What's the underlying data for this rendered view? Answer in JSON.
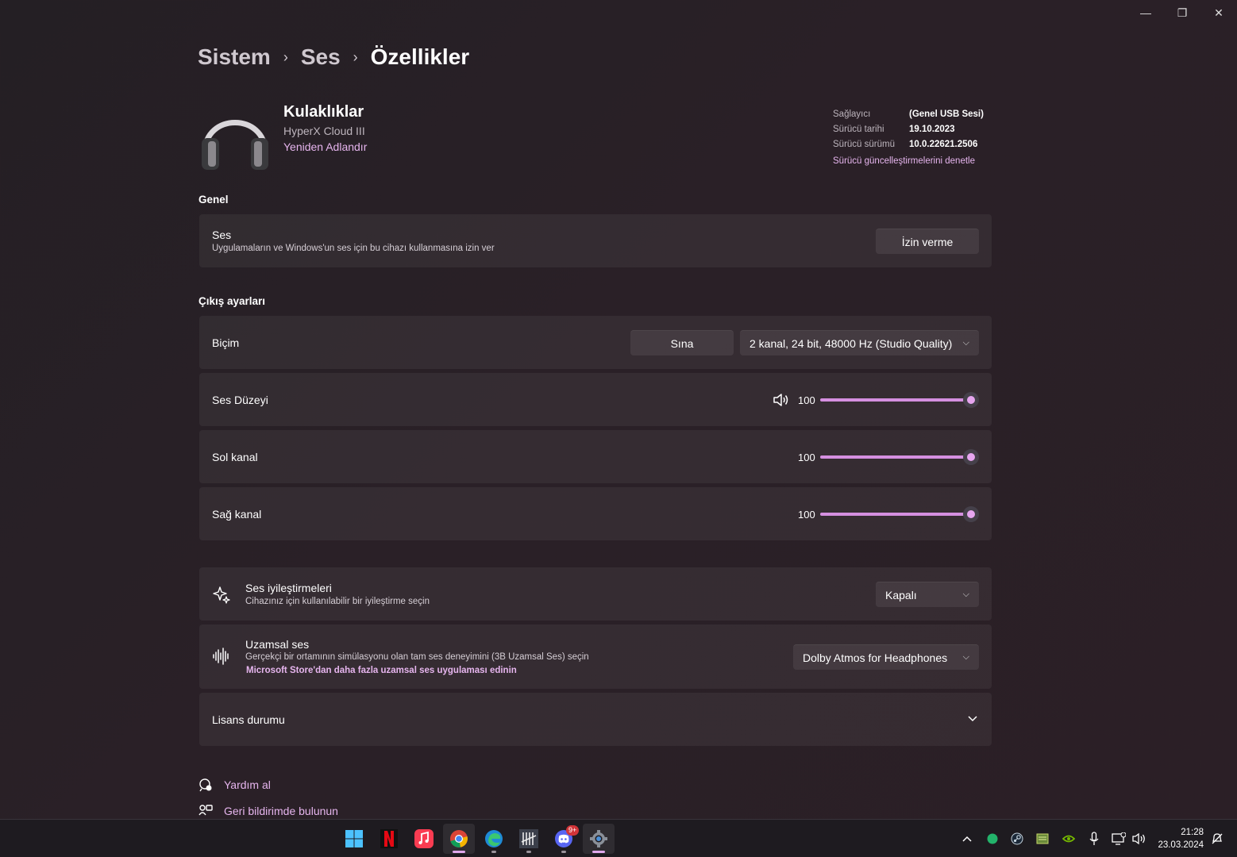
{
  "window_controls": {
    "minimize": "—",
    "restore": "❐",
    "close": "✕"
  },
  "breadcrumb": {
    "items": [
      "Sistem",
      "Ses"
    ],
    "current": "Özellikler",
    "separator": "›"
  },
  "device": {
    "name": "Kulaklıklar",
    "model": "HyperX Cloud III",
    "rename": "Yeniden Adlandır",
    "icon": "headphones-icon"
  },
  "driver": {
    "provider_label": "Sağlayıcı",
    "provider_value": "(Genel USB Sesi)",
    "date_label": "Sürücü tarihi",
    "date_value": "19.10.2023",
    "version_label": "Sürücü sürümü",
    "version_value": "10.0.22621.2506",
    "update_link": "Sürücü güncelleştirmelerini denetle"
  },
  "general": {
    "section_title": "Genel",
    "audio_title": "Ses",
    "audio_sub": "Uygulamaların ve Windows'un ses için bu cihazı kullanmasına izin ver",
    "deny_button": "İzin verme"
  },
  "output": {
    "section_title": "Çıkış ayarları",
    "format_label": "Biçim",
    "test_button": "Sına",
    "format_value": "2 kanal, 24 bit, 48000 Hz (Studio Quality)",
    "volume_label": "Ses Düzeyi",
    "volume_value": "100",
    "left_label": "Sol kanal",
    "left_value": "100",
    "right_label": "Sağ kanal",
    "right_value": "100"
  },
  "enhancements": {
    "title": "Ses iyileştirmeleri",
    "sub": "Cihazınız için kullanılabilir bir iyileştirme seçin",
    "value": "Kapalı"
  },
  "spatial": {
    "title": "Uzamsal ses",
    "sub": "Gerçekçi bir ortamının simülasyonu olan tam ses deneyimini (3B Uzamsal Ses) seçin",
    "link": "Microsoft Store'dan daha fazla uzamsal ses uygulaması edinin",
    "value": "Dolby Atmos for Headphones"
  },
  "license": {
    "title": "Lisans durumu"
  },
  "help": {
    "get_help": "Yardım al",
    "feedback": "Geri bildirimde bulunun"
  },
  "taskbar": {
    "apps": [
      "windows-start",
      "netflix",
      "apple-music",
      "chrome",
      "edge",
      "dead-by-daylight",
      "discord",
      "settings"
    ],
    "discord_badge": "9+",
    "time": "21:28",
    "date": "23.03.2024"
  },
  "colors": {
    "accent": "#e6b5ee",
    "slider": "#d58fe0",
    "background": "#262027"
  }
}
